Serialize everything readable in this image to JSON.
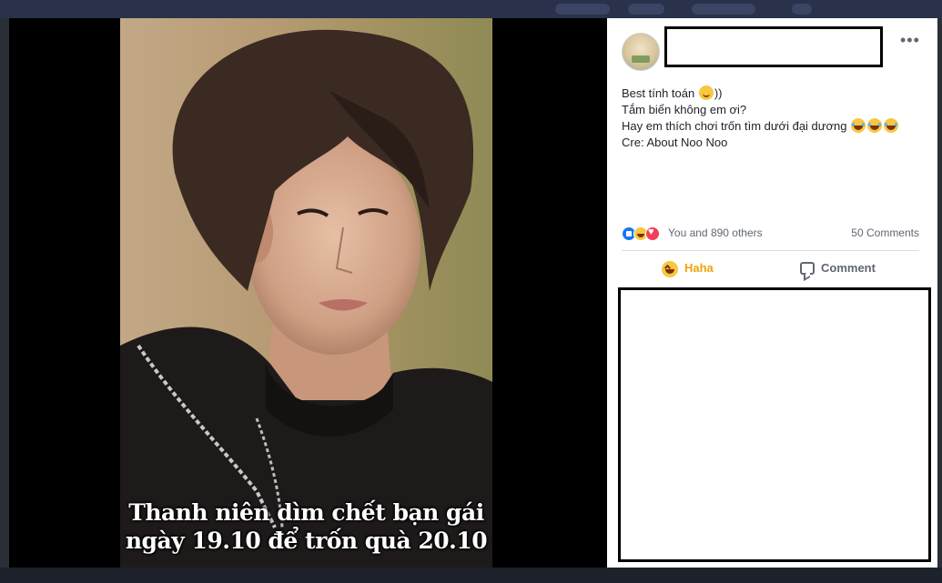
{
  "theater": {
    "photo_caption_line1": "Thanh niên dìm chết bạn gái",
    "photo_caption_line2": "ngày 19.10 để trốn quà 20.10"
  },
  "post": {
    "more_options_glyph": "•••",
    "text_line1_prefix": "Best tính toán ",
    "text_line1_suffix": "))",
    "text_line2": "Tắm biển không em ơi?",
    "text_line3": "Hay em thích chơi trốn tìm dưới đại dương",
    "text_line4": "Cre: About Noo Noo"
  },
  "reactions": {
    "icons": [
      "like-icon",
      "haha-icon",
      "love-icon"
    ],
    "summary": "You and 890 others",
    "comment_count": "50 Comments"
  },
  "actions": {
    "haha_label": "Haha",
    "comment_label": "Comment"
  },
  "colors": {
    "haha_active": "#f0a20c",
    "like_blue": "#1877f2",
    "love_red": "#f33e58",
    "muted_text": "#606770"
  }
}
